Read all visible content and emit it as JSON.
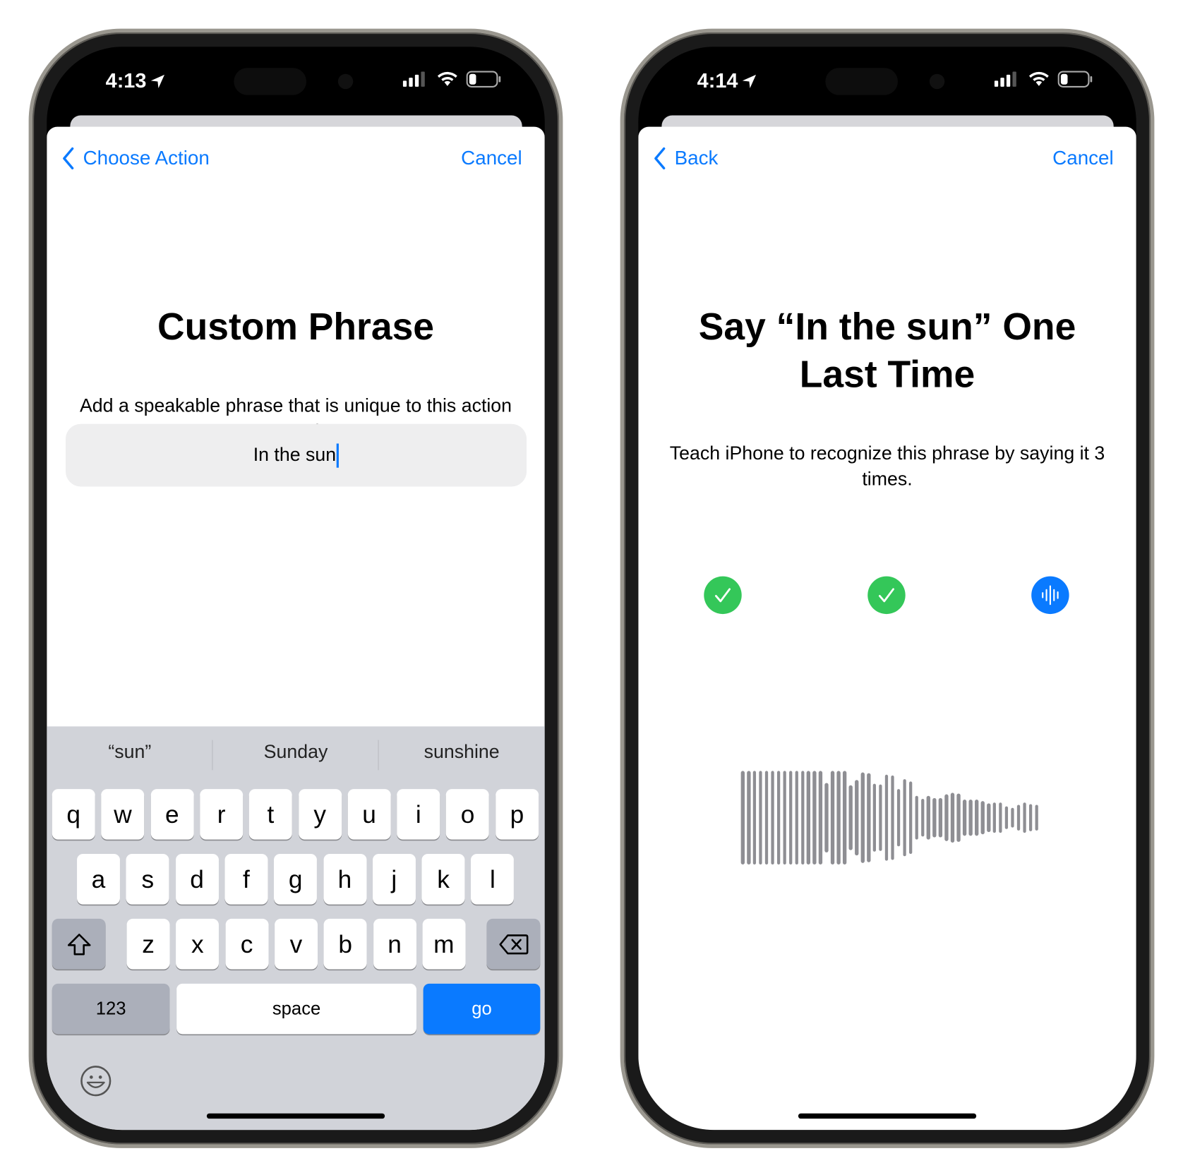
{
  "colors": {
    "accent": "#0a7aff",
    "success": "#34c759",
    "keyboard_bg": "#d1d3d9",
    "waveform": "#8e8e93"
  },
  "left_phone": {
    "status": {
      "time": "4:13",
      "icons": [
        "location-arrow-icon",
        "cellular-signal-icon",
        "wifi-icon",
        "battery-low-icon"
      ]
    },
    "nav": {
      "back_label": "Choose Action",
      "cancel_label": "Cancel"
    },
    "title": "Custom Phrase",
    "description": "Add a speakable phrase that is unique to this action to run it.",
    "phrase_input": {
      "value": "In the sun"
    },
    "keyboard": {
      "suggestions": [
        "“sun”",
        "Sunday",
        "sunshine"
      ],
      "row1": [
        "q",
        "w",
        "e",
        "r",
        "t",
        "y",
        "u",
        "i",
        "o",
        "p"
      ],
      "row2": [
        "a",
        "s",
        "d",
        "f",
        "g",
        "h",
        "j",
        "k",
        "l"
      ],
      "row3": [
        "z",
        "x",
        "c",
        "v",
        "b",
        "n",
        "m"
      ],
      "numbers_label": "123",
      "space_label": "space",
      "go_label": "go"
    }
  },
  "right_phone": {
    "status": {
      "time": "4:14",
      "icons": [
        "location-arrow-icon",
        "cellular-signal-icon",
        "wifi-icon",
        "battery-low-icon"
      ]
    },
    "nav": {
      "back_label": "Back",
      "cancel_label": "Cancel"
    },
    "title_line1": "Say “In the sun” One",
    "title_line2": "Last Time",
    "description": "Teach iPhone to recognize this phrase by saying it 3 times.",
    "progress": [
      {
        "state": "done",
        "icon": "checkmark-icon"
      },
      {
        "state": "done",
        "icon": "checkmark-icon"
      },
      {
        "state": "listening",
        "icon": "waveform-icon"
      }
    ],
    "waveform_levels": [
      1,
      1,
      1,
      1,
      1,
      1,
      1,
      1,
      1,
      1,
      1,
      1,
      1,
      1,
      0.74,
      1,
      1,
      1,
      0.69,
      0.805,
      0.96,
      0.955,
      0.73,
      0.71,
      0.92,
      0.9,
      0.61,
      0.82,
      0.77,
      0.465,
      0.41,
      0.475,
      0.415,
      0.425,
      0.505,
      0.535,
      0.51,
      0.39,
      0.39,
      0.395,
      0.36,
      0.31,
      0.325,
      0.325,
      0.24,
      0.215,
      0.275,
      0.32,
      0.29,
      0.28
    ]
  }
}
